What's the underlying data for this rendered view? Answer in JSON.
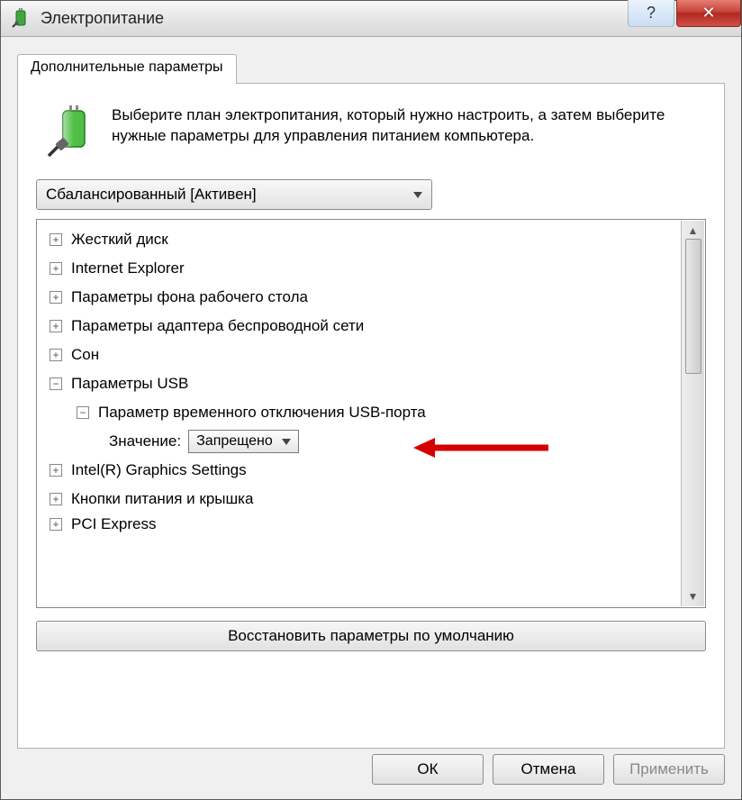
{
  "titlebar": {
    "title": "Электропитание"
  },
  "tab": {
    "label": "Дополнительные параметры"
  },
  "intro": {
    "text": "Выберите план электропитания, который нужно настроить, а затем выберите нужные параметры для управления питанием компьютера."
  },
  "plan": {
    "selected": "Сбалансированный [Активен]"
  },
  "tree": {
    "items": [
      {
        "label": "Жесткий диск"
      },
      {
        "label": "Internet Explorer"
      },
      {
        "label": "Параметры фона рабочего стола"
      },
      {
        "label": "Параметры адаптера беспроводной сети"
      },
      {
        "label": "Сон"
      },
      {
        "label": "Параметры USB"
      },
      {
        "label": "Intel(R) Graphics Settings"
      },
      {
        "label": "Кнопки питания и крышка"
      },
      {
        "label": "PCI Express"
      }
    ],
    "usb_child": {
      "label": "Параметр временного отключения USB-порта"
    },
    "value_label": "Значение:",
    "value_selected": "Запрещено"
  },
  "buttons": {
    "restore": "Восстановить параметры по умолчанию",
    "ok": "ОК",
    "cancel": "Отмена",
    "apply": "Применить"
  }
}
